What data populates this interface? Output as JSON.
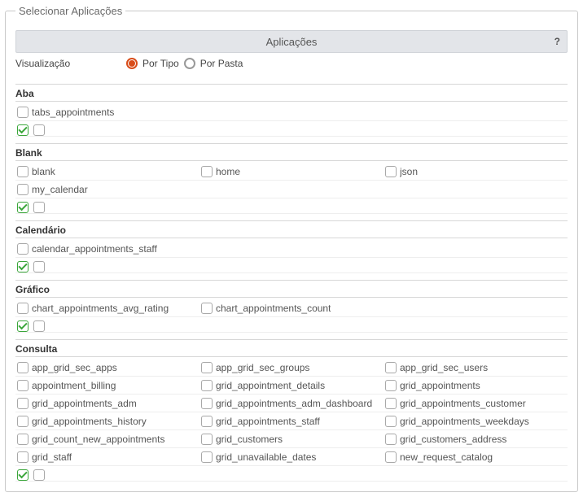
{
  "legend": "Selecionar Aplicações",
  "header": {
    "title": "Aplicações",
    "help": "?"
  },
  "viz": {
    "label": "Visualização",
    "options": {
      "by_type": "Por Tipo",
      "by_folder": "Por Pasta"
    },
    "selected": "by_type"
  },
  "sections": {
    "aba": {
      "title": "Aba",
      "items": [
        "tabs_appointments"
      ]
    },
    "blank": {
      "title": "Blank",
      "items": [
        "blank",
        "home",
        "json",
        "my_calendar"
      ]
    },
    "calendario": {
      "title": "Calendário",
      "items": [
        "calendar_appointments_staff"
      ]
    },
    "grafico": {
      "title": "Gráfico",
      "items": [
        "chart_appointments_avg_rating",
        "chart_appointments_count"
      ]
    },
    "consulta": {
      "title": "Consulta",
      "items": [
        "app_grid_sec_apps",
        "app_grid_sec_groups",
        "app_grid_sec_users",
        "appointment_billing",
        "grid_appointment_details",
        "grid_appointments",
        "grid_appointments_adm",
        "grid_appointments_adm_dashboard",
        "grid_appointments_customer",
        "grid_appointments_history",
        "grid_appointments_staff",
        "grid_appointments_weekdays",
        "grid_count_new_appointments",
        "grid_customers",
        "grid_customers_address",
        "grid_staff",
        "grid_unavailable_dates",
        "new_request_catalog"
      ]
    }
  }
}
